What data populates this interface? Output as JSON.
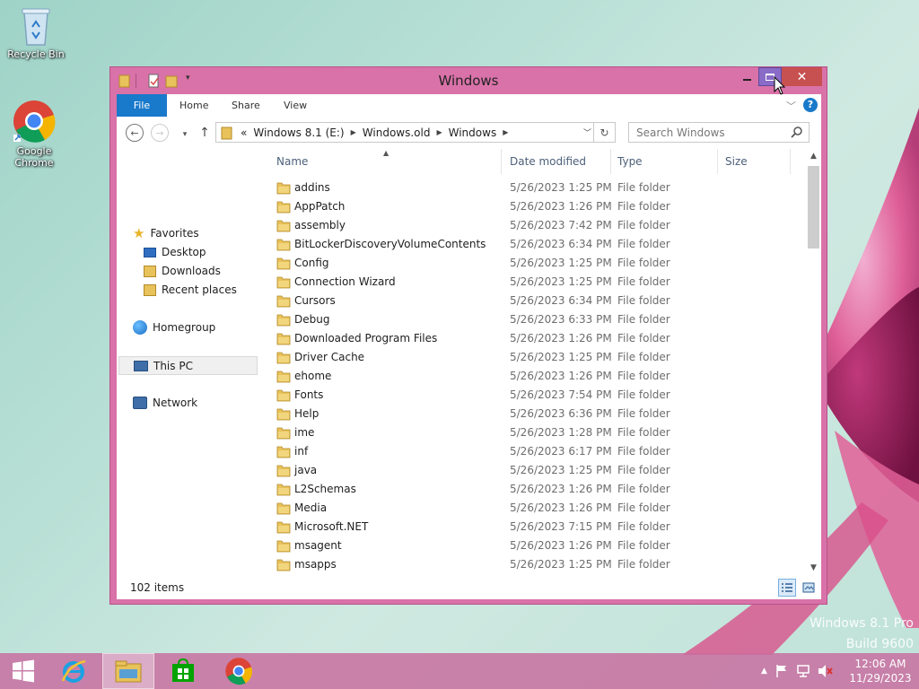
{
  "desktop": {
    "icons": [
      {
        "label": "Recycle Bin",
        "icon": "recycle-bin-icon"
      },
      {
        "label": "Google Chrome",
        "icon": "chrome-icon"
      }
    ],
    "watermark": {
      "line1": "Windows 8.1 Pro",
      "line2": "Build 9600"
    }
  },
  "window": {
    "title": "Windows",
    "controls": {
      "minimize": "minimize-icon",
      "maximize": "maximize-icon",
      "close": "close-icon"
    }
  },
  "ribbon": {
    "tabs": [
      {
        "label": "File",
        "active": true
      },
      {
        "label": "Home"
      },
      {
        "label": "Share"
      },
      {
        "label": "View"
      }
    ],
    "help": "?"
  },
  "address": {
    "overflow": "«",
    "segments": [
      "Windows 8.1 (E:)",
      "Windows.old",
      "Windows"
    ]
  },
  "search": {
    "placeholder": "Search Windows"
  },
  "navpane": {
    "favorites": "Favorites",
    "desktop": "Desktop",
    "downloads": "Downloads",
    "recent": "Recent places",
    "homegroup": "Homegroup",
    "thispc": "This PC",
    "network": "Network"
  },
  "columns": {
    "name": "Name",
    "date": "Date modified",
    "type": "Type",
    "size": "Size"
  },
  "files": [
    {
      "name": "addins",
      "date": "5/26/2023 1:25 PM",
      "type": "File folder"
    },
    {
      "name": "AppPatch",
      "date": "5/26/2023 1:26 PM",
      "type": "File folder"
    },
    {
      "name": "assembly",
      "date": "5/26/2023 7:42 PM",
      "type": "File folder"
    },
    {
      "name": "BitLockerDiscoveryVolumeContents",
      "date": "5/26/2023 6:34 PM",
      "type": "File folder"
    },
    {
      "name": "Config",
      "date": "5/26/2023 1:25 PM",
      "type": "File folder"
    },
    {
      "name": "Connection Wizard",
      "date": "5/26/2023 1:25 PM",
      "type": "File folder"
    },
    {
      "name": "Cursors",
      "date": "5/26/2023 6:34 PM",
      "type": "File folder"
    },
    {
      "name": "Debug",
      "date": "5/26/2023 6:33 PM",
      "type": "File folder"
    },
    {
      "name": "Downloaded Program Files",
      "date": "5/26/2023 1:26 PM",
      "type": "File folder"
    },
    {
      "name": "Driver Cache",
      "date": "5/26/2023 1:25 PM",
      "type": "File folder"
    },
    {
      "name": "ehome",
      "date": "5/26/2023 1:26 PM",
      "type": "File folder"
    },
    {
      "name": "Fonts",
      "date": "5/26/2023 7:54 PM",
      "type": "File folder"
    },
    {
      "name": "Help",
      "date": "5/26/2023 6:36 PM",
      "type": "File folder"
    },
    {
      "name": "ime",
      "date": "5/26/2023 1:28 PM",
      "type": "File folder"
    },
    {
      "name": "inf",
      "date": "5/26/2023 6:17 PM",
      "type": "File folder"
    },
    {
      "name": "java",
      "date": "5/26/2023 1:25 PM",
      "type": "File folder"
    },
    {
      "name": "L2Schemas",
      "date": "5/26/2023 1:26 PM",
      "type": "File folder"
    },
    {
      "name": "Media",
      "date": "5/26/2023 1:26 PM",
      "type": "File folder"
    },
    {
      "name": "Microsoft.NET",
      "date": "5/26/2023 7:15 PM",
      "type": "File folder"
    },
    {
      "name": "msagent",
      "date": "5/26/2023 1:26 PM",
      "type": "File folder"
    },
    {
      "name": "msapps",
      "date": "5/26/2023 1:25 PM",
      "type": "File folder"
    }
  ],
  "status": {
    "item_count": "102 items"
  },
  "taskbar": {
    "apps": [
      "start-icon",
      "internet-explorer-icon",
      "file-explorer-icon",
      "store-icon",
      "chrome-icon"
    ],
    "tray": [
      "show-hidden-icons",
      "action-center-flag-icon",
      "network-icon",
      "volume-muted-icon"
    ],
    "time": "12:06 AM",
    "date": "11/29/2023"
  },
  "colors": {
    "accent": "#1979ca",
    "window_frame": "#d972a8",
    "close": "#c75050",
    "folder": "#e8c25a"
  }
}
